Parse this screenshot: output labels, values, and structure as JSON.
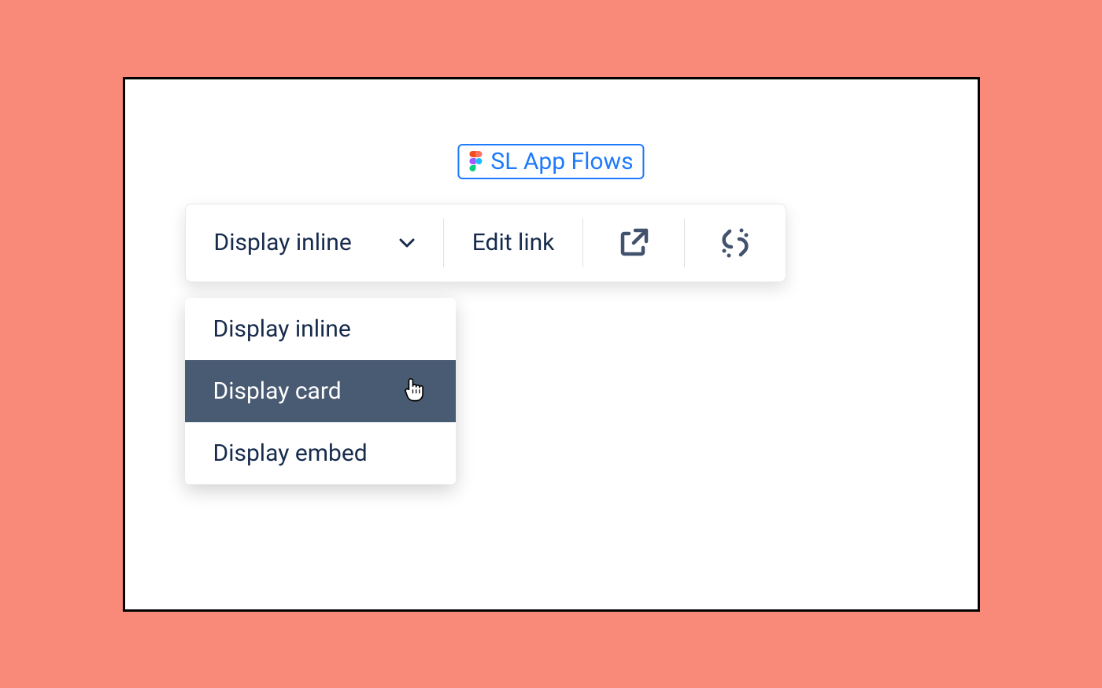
{
  "linkChip": {
    "label": "SL App Flows",
    "iconName": "figma-icon"
  },
  "toolbar": {
    "displaySelect": {
      "label": "Display inline"
    },
    "editLink": {
      "label": "Edit link"
    }
  },
  "dropdown": {
    "items": [
      {
        "label": "Display inline",
        "hovered": false
      },
      {
        "label": "Display card",
        "hovered": true
      },
      {
        "label": "Display embed",
        "hovered": false
      }
    ]
  }
}
